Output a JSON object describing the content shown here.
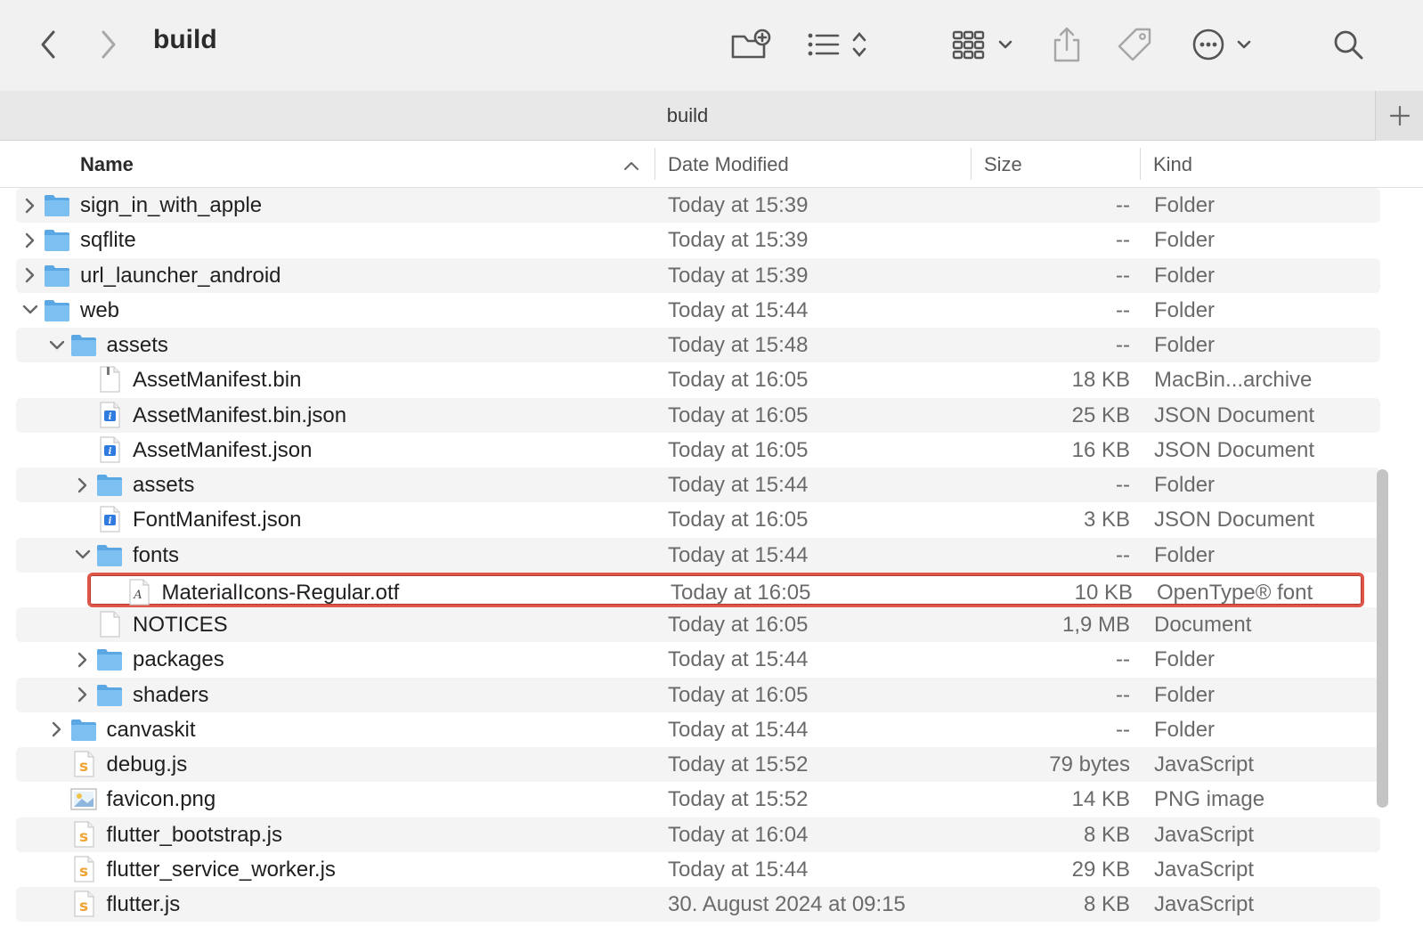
{
  "toolbar": {
    "title": "build",
    "back": "back",
    "forward": "forward",
    "icons": [
      "new-folder-icon",
      "list-view-icon",
      "group-icon",
      "share-icon",
      "tag-icon",
      "more-icon",
      "search-icon"
    ]
  },
  "tabs": [
    {
      "label": "build"
    }
  ],
  "columns": {
    "name": "Name",
    "date": "Date Modified",
    "size": "Size",
    "kind": "Kind"
  },
  "colors": {
    "folder": "#6fb7ec",
    "selection_border": "#e0574a",
    "script": "#f0a330",
    "json": "#2f7be0"
  },
  "rows": [
    {
      "name": "sign_in_with_apple",
      "date": "Today at 15:39",
      "size": "--",
      "kind": "Folder",
      "level": 0,
      "type": "folder",
      "disclosure": "closed"
    },
    {
      "name": "sqflite",
      "date": "Today at 15:39",
      "size": "--",
      "kind": "Folder",
      "level": 0,
      "type": "folder",
      "disclosure": "closed"
    },
    {
      "name": "url_launcher_android",
      "date": "Today at 15:39",
      "size": "--",
      "kind": "Folder",
      "level": 0,
      "type": "folder",
      "disclosure": "closed"
    },
    {
      "name": "web",
      "date": "Today at 15:44",
      "size": "--",
      "kind": "Folder",
      "level": 0,
      "type": "folder",
      "disclosure": "open"
    },
    {
      "name": "assets",
      "date": "Today at 15:48",
      "size": "--",
      "kind": "Folder",
      "level": 1,
      "type": "folder",
      "disclosure": "open"
    },
    {
      "name": "AssetManifest.bin",
      "date": "Today at 16:05",
      "size": "18 KB",
      "kind": "MacBin...archive",
      "level": 2,
      "type": "bin",
      "disclosure": "none"
    },
    {
      "name": "AssetManifest.bin.json",
      "date": "Today at 16:05",
      "size": "25 KB",
      "kind": "JSON Document",
      "level": 2,
      "type": "json",
      "disclosure": "none"
    },
    {
      "name": "AssetManifest.json",
      "date": "Today at 16:05",
      "size": "16 KB",
      "kind": "JSON Document",
      "level": 2,
      "type": "json",
      "disclosure": "none"
    },
    {
      "name": "assets",
      "date": "Today at 15:44",
      "size": "--",
      "kind": "Folder",
      "level": 2,
      "type": "folder",
      "disclosure": "closed"
    },
    {
      "name": "FontManifest.json",
      "date": "Today at 16:05",
      "size": "3 KB",
      "kind": "JSON Document",
      "level": 2,
      "type": "json",
      "disclosure": "none"
    },
    {
      "name": "fonts",
      "date": "Today at 15:44",
      "size": "--",
      "kind": "Folder",
      "level": 2,
      "type": "folder",
      "disclosure": "open"
    },
    {
      "name": "MaterialIcons-Regular.otf",
      "date": "Today at 16:05",
      "size": "10 KB",
      "kind": "OpenType® font",
      "level": 3,
      "type": "font",
      "disclosure": "none",
      "selected": true
    },
    {
      "name": "NOTICES",
      "date": "Today at 16:05",
      "size": "1,9 MB",
      "kind": "Document",
      "level": 2,
      "type": "doc",
      "disclosure": "none"
    },
    {
      "name": "packages",
      "date": "Today at 15:44",
      "size": "--",
      "kind": "Folder",
      "level": 2,
      "type": "folder",
      "disclosure": "closed"
    },
    {
      "name": "shaders",
      "date": "Today at 16:05",
      "size": "--",
      "kind": "Folder",
      "level": 2,
      "type": "folder",
      "disclosure": "closed"
    },
    {
      "name": "canvaskit",
      "date": "Today at 15:44",
      "size": "--",
      "kind": "Folder",
      "level": 1,
      "type": "folder",
      "disclosure": "closed"
    },
    {
      "name": "debug.js",
      "date": "Today at 15:52",
      "size": "79 bytes",
      "kind": "JavaScript",
      "level": 1,
      "type": "js",
      "disclosure": "none"
    },
    {
      "name": "favicon.png",
      "date": "Today at 15:52",
      "size": "14 KB",
      "kind": "PNG image",
      "level": 1,
      "type": "png",
      "disclosure": "none"
    },
    {
      "name": "flutter_bootstrap.js",
      "date": "Today at 16:04",
      "size": "8 KB",
      "kind": "JavaScript",
      "level": 1,
      "type": "js",
      "disclosure": "none"
    },
    {
      "name": "flutter_service_worker.js",
      "date": "Today at 15:44",
      "size": "29 KB",
      "kind": "JavaScript",
      "level": 1,
      "type": "js",
      "disclosure": "none"
    },
    {
      "name": "flutter.js",
      "date": "30. August 2024 at 09:15",
      "size": "8 KB",
      "kind": "JavaScript",
      "level": 1,
      "type": "js",
      "disclosure": "none"
    }
  ]
}
